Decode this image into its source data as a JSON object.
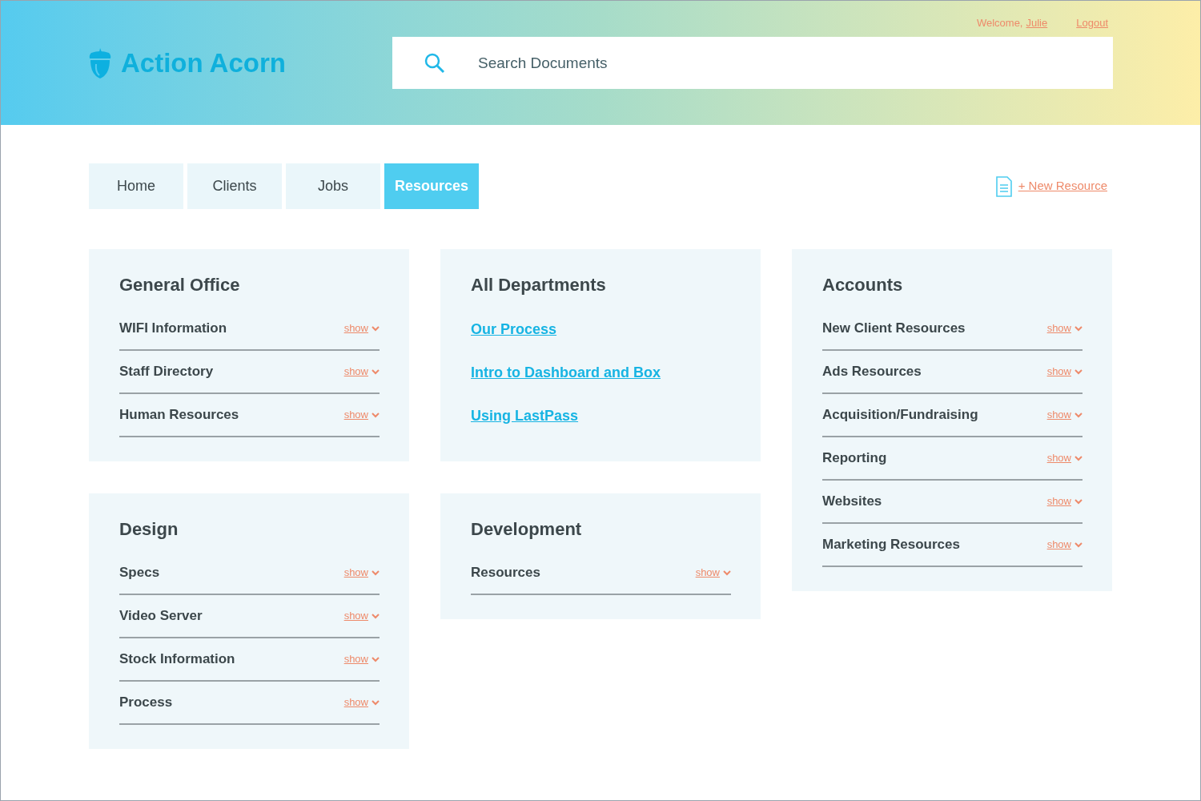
{
  "header": {
    "logo": "Action Acorn",
    "welcome": "Welcome,",
    "user": "Julie",
    "logout": "Logout",
    "search": {
      "placeholder": "Search Documents"
    }
  },
  "tabs": [
    {
      "label": "Home",
      "selected": false
    },
    {
      "label": "Clients",
      "selected": false
    },
    {
      "label": "Jobs",
      "selected": false
    },
    {
      "label": "Resources",
      "selected": true
    }
  ],
  "new_resource": "+ New Resource",
  "columns": [
    [
      {
        "title": "General Office",
        "items": [
          {
            "kind": "toggle",
            "label": "WIFI Information",
            "action": "show"
          },
          {
            "kind": "toggle",
            "label": "Staff Directory",
            "action": "show"
          },
          {
            "kind": "toggle",
            "label": "Human Resources",
            "action": "show"
          }
        ]
      },
      {
        "title": "Design",
        "items": [
          {
            "kind": "toggle",
            "label": "Specs",
            "action": "show"
          },
          {
            "kind": "toggle",
            "label": "Video Server",
            "action": "show"
          },
          {
            "kind": "toggle",
            "label": "Stock Information",
            "action": "show"
          },
          {
            "kind": "toggle",
            "label": "Process",
            "action": "show"
          }
        ]
      }
    ],
    [
      {
        "title": "All Departments",
        "items": [
          {
            "kind": "link",
            "label": "Our Process"
          },
          {
            "kind": "link",
            "label": "Intro to Dashboard and Box"
          },
          {
            "kind": "link",
            "label": "Using LastPass"
          }
        ]
      },
      {
        "title": "Development",
        "items": [
          {
            "kind": "toggle",
            "label": "Resources",
            "action": "show"
          }
        ]
      }
    ],
    [
      {
        "title": "Accounts",
        "items": [
          {
            "kind": "toggle",
            "label": "New Client Resources",
            "action": "show"
          },
          {
            "kind": "toggle",
            "label": "Ads Resources",
            "action": "show"
          },
          {
            "kind": "toggle",
            "label": "Acquisition/Fundraising",
            "action": "show"
          },
          {
            "kind": "toggle",
            "label": "Reporting",
            "action": "show"
          },
          {
            "kind": "toggle",
            "label": "Websites",
            "action": "show"
          },
          {
            "kind": "toggle",
            "label": "Marketing Resources",
            "action": "show"
          }
        ]
      }
    ]
  ]
}
